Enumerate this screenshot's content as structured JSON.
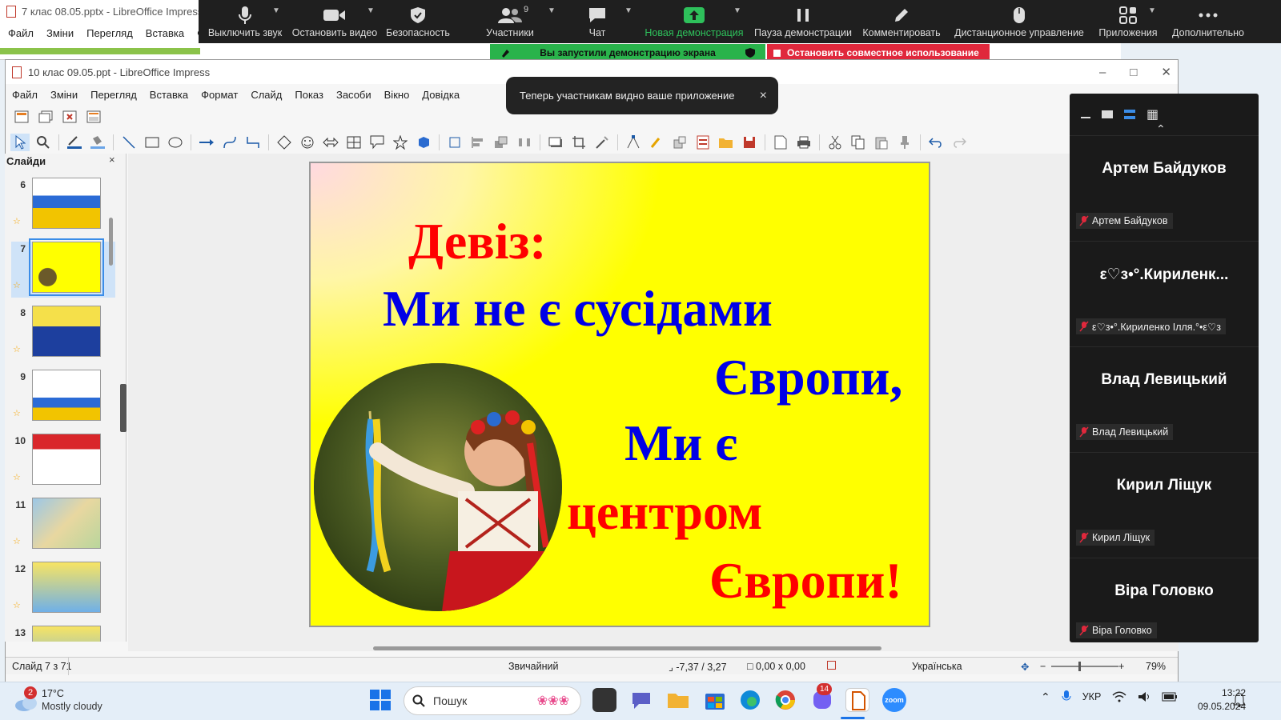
{
  "bg_window": {
    "title": "7 клас 08.05.pptx - LibreOffice Impress",
    "menu": [
      "Файл",
      "Зміни",
      "Перегляд",
      "Вставка",
      "Фо"
    ]
  },
  "zoom_toolbar": {
    "mute": "Выключить звук",
    "video": "Остановить видео",
    "security": "Безопасность",
    "participants": "Участники",
    "participants_count": "9",
    "chat": "Чат",
    "new_share": "Новая демонстрация",
    "pause": "Пауза демонстрации",
    "annotate": "Комментировать",
    "remote": "Дистанционное управление",
    "apps": "Приложения",
    "more": "Дополнительно"
  },
  "share_banner": {
    "status": "Вы запустили демонстрацию экрана",
    "stop": "Остановить совместное использование"
  },
  "toast": {
    "text": "Теперь участникам видно ваше приложение",
    "close": "×"
  },
  "window": {
    "title": "10 клас 09.05.ppt - LibreOffice Impress",
    "menu": [
      "Файл",
      "Зміни",
      "Перегляд",
      "Вставка",
      "Формат",
      "Слайд",
      "Показ",
      "Засоби",
      "Вікно",
      "Довідка"
    ]
  },
  "slides_panel": {
    "title": "Слайди",
    "close": "×",
    "thumbs": [
      {
        "num": "6"
      },
      {
        "num": "7"
      },
      {
        "num": "8"
      },
      {
        "num": "9"
      },
      {
        "num": "10"
      },
      {
        "num": "11"
      },
      {
        "num": "12"
      },
      {
        "num": "13"
      }
    ]
  },
  "slide": {
    "line1": "Девіз:",
    "line2": "Ми  не  є  сусідами",
    "line3": "Європи,",
    "line4": "Ми   є",
    "line5": "центром",
    "line6": "Європи!"
  },
  "status": {
    "slide": "Слайд 7 з 71",
    "layout": "Звичайний",
    "position": "-7,37 / 3,27",
    "size": "0,00 x 0,00",
    "language": "Українська",
    "zoom": "79%"
  },
  "participants": [
    {
      "big": "Артем Байдуков",
      "small": "Артем Байдуков"
    },
    {
      "big": "ε♡з•°.Кириленк...",
      "small": "ε♡з•°.Кириленко Ілля.°•ε♡з"
    },
    {
      "big": "Влад Левицький",
      "small": "Влад Левицький"
    },
    {
      "big": "Кирил Ліщук",
      "small": "Кирил Ліщук"
    },
    {
      "big": "Віра Головко",
      "small": "Віра Головко"
    }
  ],
  "taskbar": {
    "weather_badge": "2",
    "temp": "17°C",
    "weather": "Mostly cloudy",
    "search": "Пошук",
    "viber_badge": "14",
    "zoom_app": "zoom",
    "lang": "УКР",
    "time": "13:22",
    "date": "09.05.2024"
  },
  "colors": {
    "slide_bg": "#ffff00",
    "slide_red": "#ff0000",
    "slide_blue": "#0000e6",
    "zoom_bar": "#1f1f1f",
    "share_green": "#29b34b",
    "share_red": "#e0283c"
  }
}
